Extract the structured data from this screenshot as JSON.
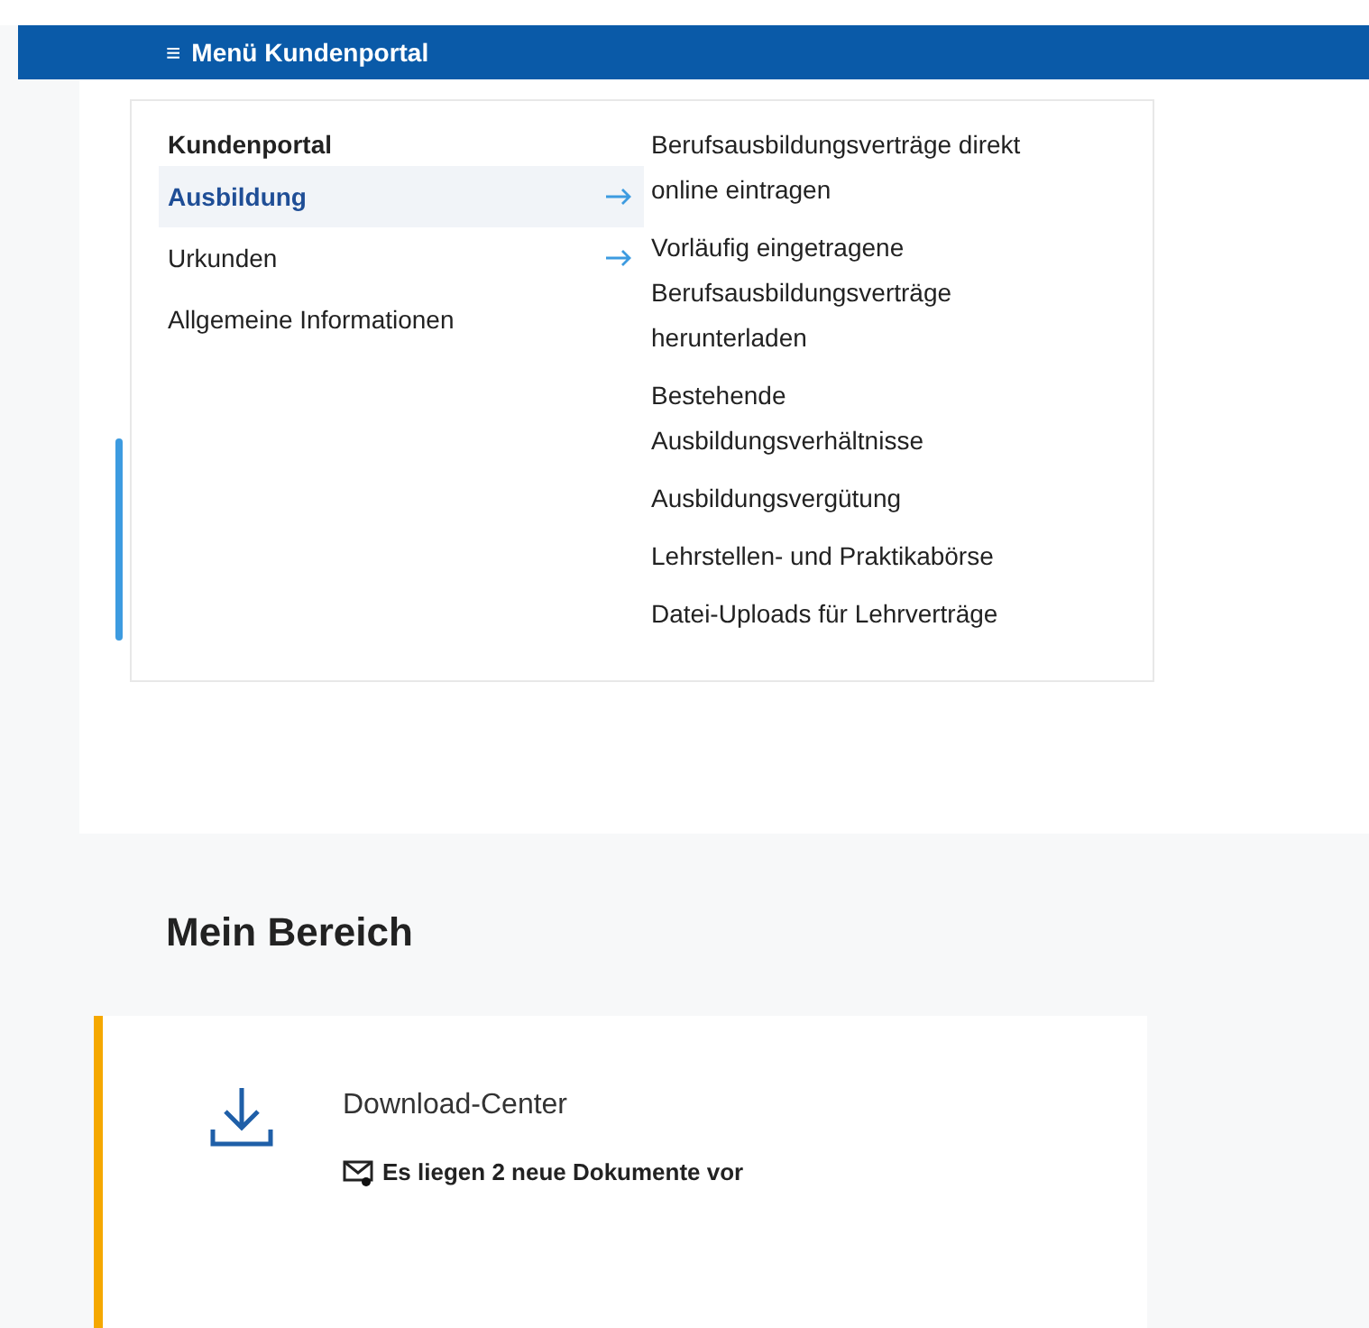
{
  "menu_bar": {
    "icon": "≡",
    "title": "Menü Kundenportal"
  },
  "menu": {
    "heading": "Kundenportal",
    "items": [
      {
        "label": "Ausbildung",
        "selected": true,
        "has_submenu": true
      },
      {
        "label": "Urkunden",
        "selected": false,
        "has_submenu": true
      },
      {
        "label": "Allgemeine Informationen",
        "selected": false,
        "has_submenu": false
      }
    ],
    "submenu": [
      "Berufsausbildungsverträge direkt online eintragen",
      "Vorläufig eingetragene Berufsausbildungsverträge herunterladen",
      "Bestehende Ausbildungsverhältnisse",
      "Ausbildungsvergütung",
      "Lehrstellen- und Praktikabörse",
      "Datei-Uploads für Lehrverträge"
    ]
  },
  "section": {
    "title": "Mein Bereich",
    "card": {
      "title": "Download-Center",
      "message": "Es liegen 2 neue Dokumente vor",
      "unread": true
    }
  }
}
